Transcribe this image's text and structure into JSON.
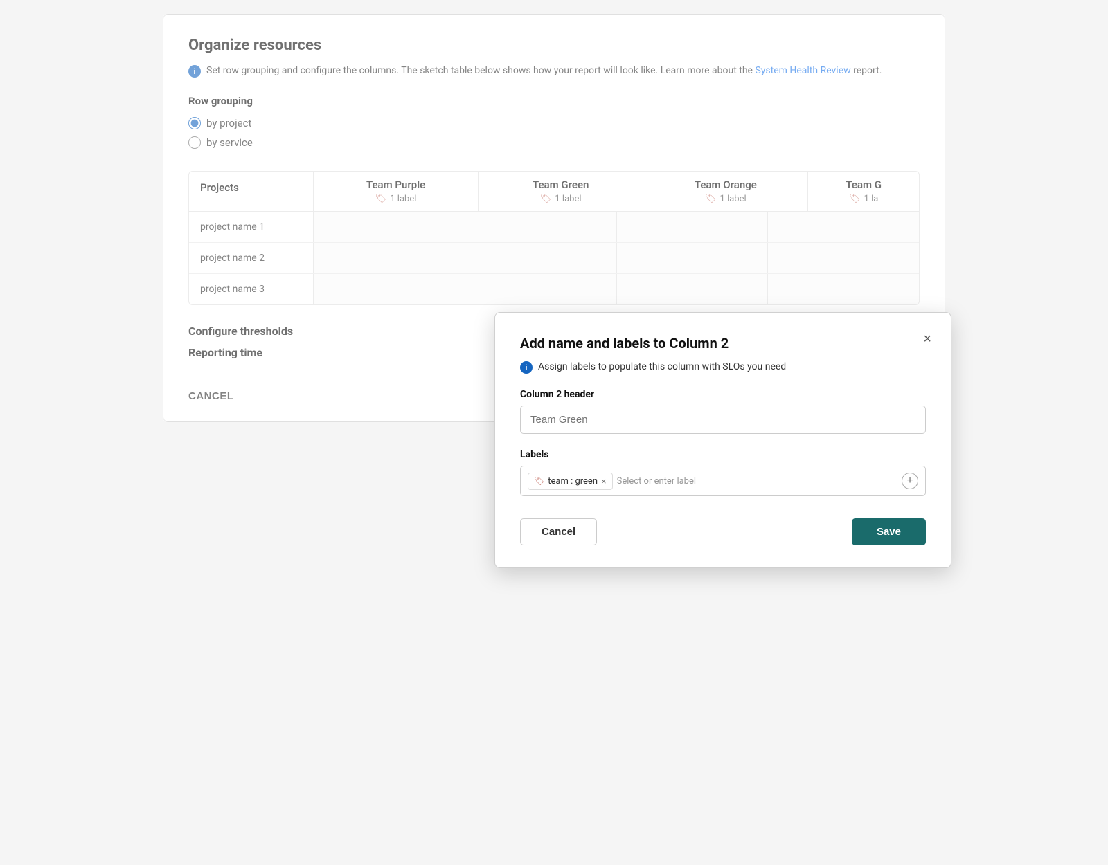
{
  "page": {
    "title": "Organize resources",
    "description": "Set row grouping and configure the columns. The sketch table below shows how your report will look like. Learn more about the",
    "link_text": "System Health Review",
    "description_end": "report.",
    "info_icon": "i"
  },
  "row_grouping": {
    "label": "Row grouping",
    "options": [
      {
        "id": "by-project",
        "label": "by project",
        "checked": true
      },
      {
        "id": "by-service",
        "label": "by service",
        "checked": false
      }
    ]
  },
  "table": {
    "projects_header": "Projects",
    "columns": [
      {
        "name": "Team Purple",
        "label_count": "1 label"
      },
      {
        "name": "Team Green",
        "label_count": "1 label"
      },
      {
        "name": "Team Orange",
        "label_count": "1 label"
      },
      {
        "name": "Team G",
        "label_count": "1 la"
      }
    ],
    "rows": [
      {
        "project": "project name 1"
      },
      {
        "project": "project name 2"
      },
      {
        "project": "project name 3"
      }
    ]
  },
  "sections": {
    "configure_thresholds": "Configure thresholds",
    "reporting_time": "Reporting time"
  },
  "bottom": {
    "cancel_label": "CANCEL"
  },
  "modal": {
    "title": "Add name and labels to Column 2",
    "close_label": "×",
    "info_text": "Assign labels to populate this column with SLOs you need",
    "field_label": "Column 2 header",
    "input_placeholder": "Team Green",
    "labels_section_label": "Labels",
    "existing_label": "team : green",
    "label_remove": "×",
    "label_input_placeholder": "Select or enter label",
    "cancel_label": "Cancel",
    "save_label": "Save"
  }
}
